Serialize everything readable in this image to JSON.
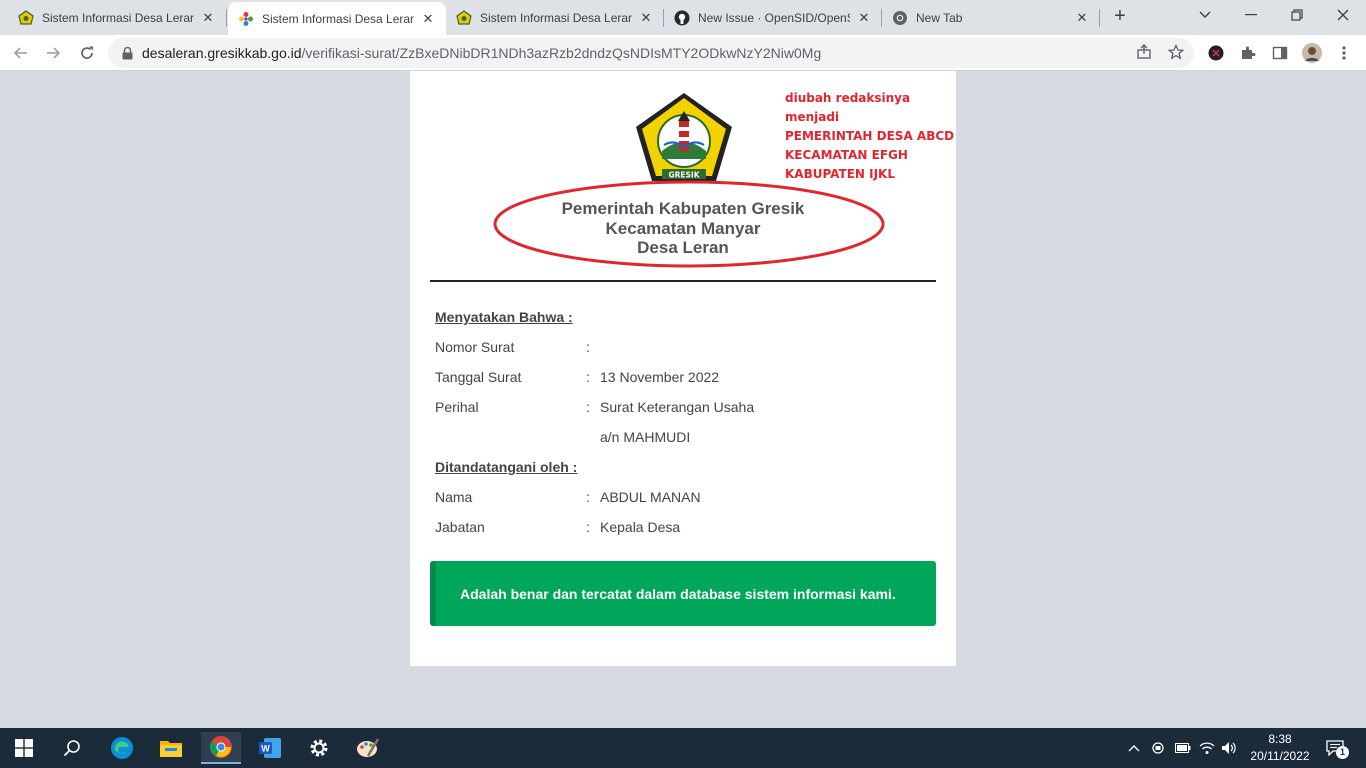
{
  "browser": {
    "tabs": [
      {
        "title": "Sistem Informasi Desa Leran",
        "favicon": "gresik-seal-icon"
      },
      {
        "title": "Sistem Informasi Desa Leran",
        "favicon": "opensid-flower-icon",
        "active": true
      },
      {
        "title": "Sistem Informasi Desa Leran",
        "favicon": "gresik-seal-icon"
      },
      {
        "title": "New Issue · OpenSID/OpenSID",
        "favicon": "github-icon"
      },
      {
        "title": "New Tab",
        "favicon": "chrome-icon"
      }
    ],
    "new_tab_glyph": "+",
    "url_host": "desaleran.gresikkab.go.id",
    "url_path": "/verifikasi-surat/ZzBxeDNibDR1NDh3azRzb2dndzQsNDIsMTY2ODkwNzY2Niw0Mg",
    "accent": "#1a73e8"
  },
  "page": {
    "annotation_lines": [
      "diubah redaksinya menjadi",
      "PEMERINTAH DESA ABCD",
      "KECAMATAN EFGH",
      "KABUPATEN IJKL"
    ],
    "annotation_color": "#e0262f",
    "logo_text": "GRESIK",
    "heading": {
      "line1": "Pemerintah Kabupaten Gresik",
      "line2": "Kecamatan Manyar",
      "line3": "Desa Leran"
    },
    "section1_label": "Menyatakan Bahwa :",
    "nomor_label": "Nomor Surat",
    "nomor_value": "",
    "tanggal_label": "Tanggal Surat",
    "tanggal_value": "13 November 2022",
    "perihal_label": "Perihal",
    "perihal_value": "Surat Keterangan Usaha",
    "perihal_value2": "a/n MAHMUDI",
    "section2_label": "Ditandatangani oleh :",
    "nama_label": "Nama",
    "nama_value": "ABDUL MANAN",
    "jabatan_label": "Jabatan",
    "jabatan_value": "Kepala Desa",
    "colon": ":",
    "success_message": "Adalah benar dan tercatat dalam database sistem informasi kami.",
    "success_color": "#00a65a"
  },
  "taskbar": {
    "time": "8:38",
    "date": "20/11/2022",
    "notification_count": "1",
    "apps": [
      "windows-start-icon",
      "search-icon",
      "edge-icon",
      "file-explorer-icon",
      "chrome-icon",
      "word-icon",
      "settings-icon",
      "paint-icon"
    ]
  }
}
